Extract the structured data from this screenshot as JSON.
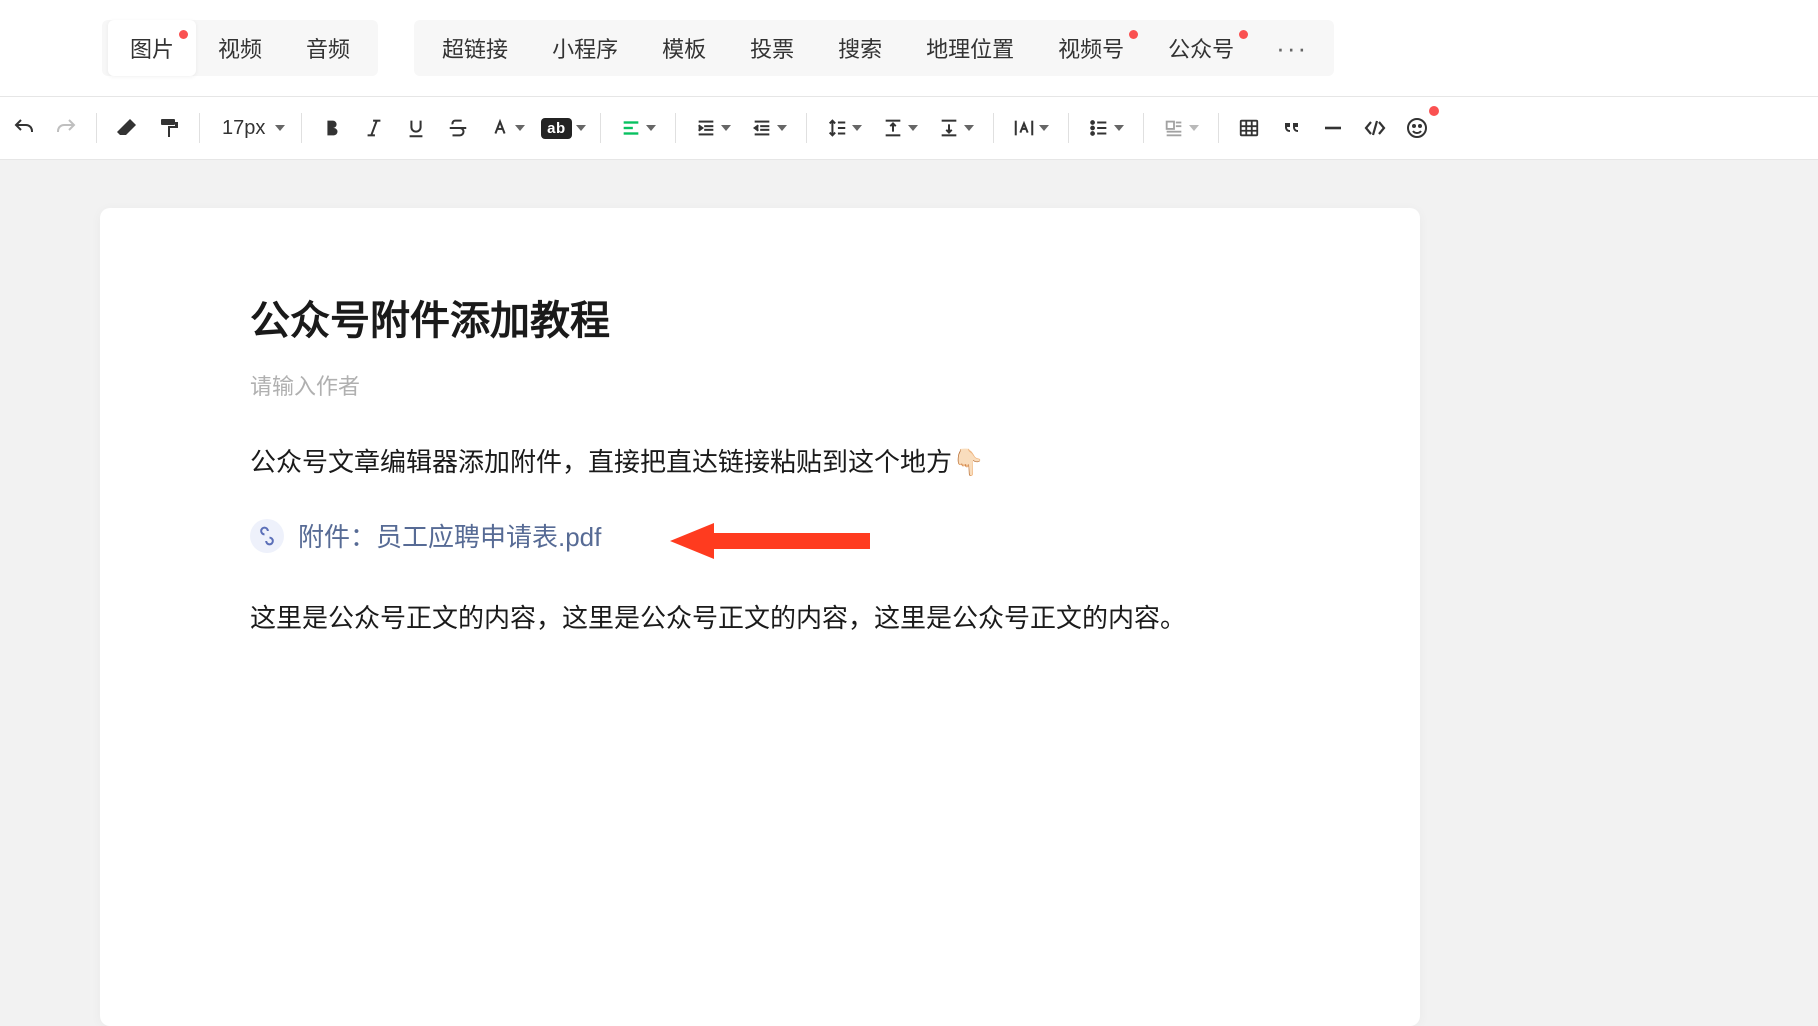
{
  "insert_menu": {
    "group1": [
      {
        "label": "图片",
        "dot": true
      },
      {
        "label": "视频",
        "dot": false
      },
      {
        "label": "音频",
        "dot": false
      }
    ],
    "group2": [
      {
        "label": "超链接",
        "dot": false
      },
      {
        "label": "小程序",
        "dot": false
      },
      {
        "label": "模板",
        "dot": false
      },
      {
        "label": "投票",
        "dot": false
      },
      {
        "label": "搜索",
        "dot": false
      },
      {
        "label": "地理位置",
        "dot": false
      },
      {
        "label": "视频号",
        "dot": true
      },
      {
        "label": "公众号",
        "dot": true
      }
    ],
    "more_label": "···"
  },
  "toolbar": {
    "font_size": "17px"
  },
  "article": {
    "title": "公众号附件添加教程",
    "author_placeholder": "请输入作者",
    "paragraph1": "公众号文章编辑器添加附件，直接把直达链接粘贴到这个地方👇🏻",
    "attachment_text": "附件：员工应聘申请表.pdf",
    "paragraph2": "这里是公众号正文的内容，这里是公众号正文的内容，这里是公众号正文的内容。"
  }
}
